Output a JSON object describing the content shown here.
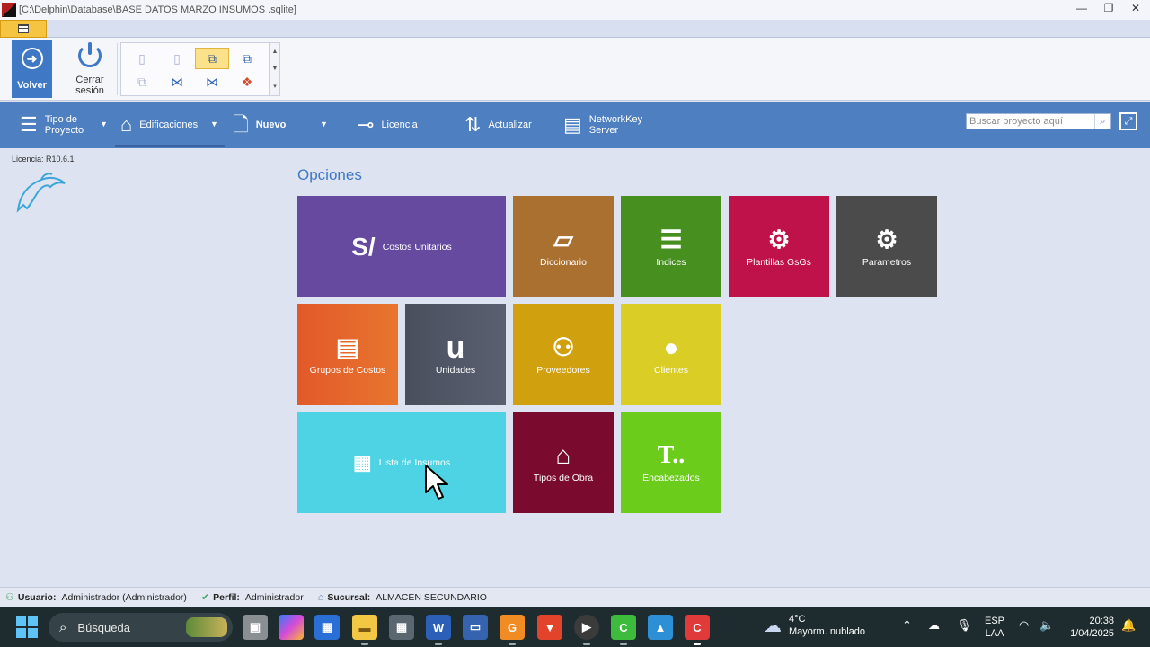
{
  "window": {
    "title": "[C:\\Delphin\\Database\\BASE DATOS MARZO INSUMOS .sqlite]",
    "minimize": "—",
    "restore": "❐",
    "close": "✕"
  },
  "ribbon": {
    "volver_label": "Volver",
    "cerrar_label": "Cerrar\nsesión"
  },
  "toolbar": {
    "tipo_proyecto": "Tipo de\nProyecto",
    "edificaciones": "Edificaciones",
    "nuevo": "Nuevo",
    "licencia": "Licencia",
    "actualizar": "Actualizar",
    "networkkey": "NetworkKey\nServer",
    "search_placeholder": "Buscar proyecto aquí"
  },
  "left_panel": {
    "licencia": "Licencia: R10.6.1"
  },
  "opciones": {
    "title": "Opciones",
    "tiles": {
      "costos": {
        "label": "Costos Unitarios",
        "icon": "S/",
        "color": "#654aa0"
      },
      "diccionario": {
        "label": "Diccionario",
        "color": "#a9702f"
      },
      "indices": {
        "label": "Indices",
        "color": "#47901f"
      },
      "plantillas": {
        "label": "Plantillas GsGs",
        "color": "#c0124a"
      },
      "parametros": {
        "label": "Parametros",
        "color": "#4b4b4b"
      },
      "grupos": {
        "label": "Grupos de Costos",
        "color": "#e2592a"
      },
      "unidades": {
        "label": "Unidades",
        "icon": "u",
        "color": "#4f5564"
      },
      "proveedores": {
        "label": "Proveedores",
        "color": "#d1a00f"
      },
      "clientes": {
        "label": "Clientes",
        "color": "#d9cd26"
      },
      "insumos": {
        "label": "Lista de Insumos",
        "color": "#4ed3e4"
      },
      "tipos_obra": {
        "label": "Tipos de Obra",
        "color": "#7a0b2e"
      },
      "encabezados": {
        "label": "Encabezados",
        "icon": "T..",
        "color": "#6ccc1c"
      }
    }
  },
  "status": {
    "usuario_key": "Usuario:",
    "usuario_val": "Administrador (Administrador)",
    "perfil_key": "Perfil:",
    "perfil_val": "Administrador",
    "sucursal_key": "Sucursal:",
    "sucursal_val": "ALMACEN SECUNDARIO"
  },
  "taskbar": {
    "search_placeholder": "Búsqueda",
    "weather_temp": "4°C",
    "weather_desc": "Mayorm. nublado",
    "lang_1": "ESP",
    "lang_2": "LAA",
    "time": "20:38",
    "date": "1/04/2025"
  }
}
